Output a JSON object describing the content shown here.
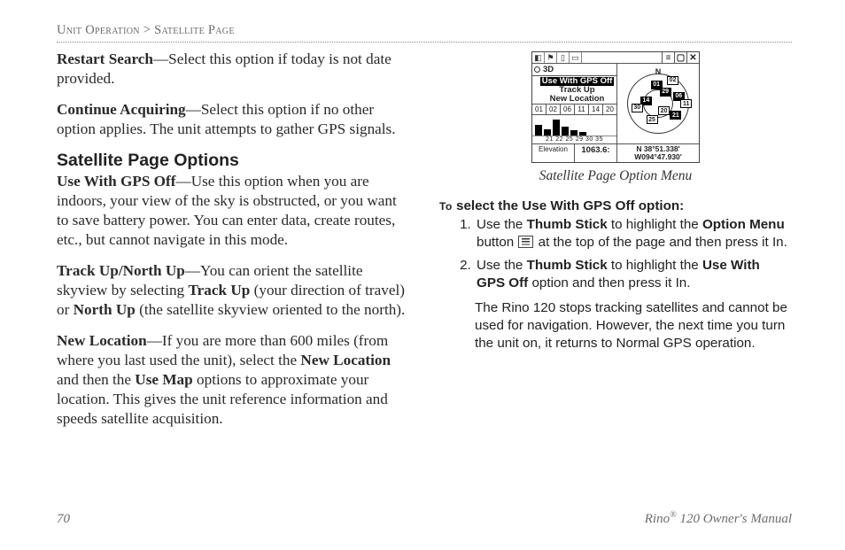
{
  "breadcrumb": {
    "section": "Unit Operation",
    "sep": ">",
    "page": "Satellite Page"
  },
  "left": {
    "p1_b": "Restart Search",
    "p1_t": "—Select this option if today is not date provided.",
    "p2_b": "Continue Acquiring",
    "p2_t": "—Select this option if no other option applies. The unit attempts to gather GPS signals.",
    "h": "Satellite Page Options",
    "p3_b": "Use With GPS Off",
    "p3_t": "—Use this option when you are indoors, your view of the sky is obstructed, or you want to save battery power. You can enter data, create routes, etc., but cannot navigate in this mode.",
    "p4_b1": "Track Up/North Up",
    "p4_t1": "—You can orient the satellite skyview by selecting ",
    "p4_b2": "Track Up",
    "p4_t2": " (your direction of travel) or ",
    "p4_b3": "North Up",
    "p4_t3": " (the satellite skyview oriented to the north).",
    "p5_b1": "New Location",
    "p5_t1": "—If you are more than 600 miles (from where you last used the unit), select the ",
    "p5_b2": "New Location",
    "p5_t2": " and then the ",
    "p5_b3": "Use Map",
    "p5_t3": " options to approximate your location. This gives the unit reference information and speeds satellite acquisition."
  },
  "right": {
    "caption": "Satellite Page Option Menu",
    "device": {
      "topbar_icons": [
        "◧",
        "⚑",
        "▯",
        "▭"
      ],
      "topbar_right": [
        "≡",
        "▢",
        "✕"
      ],
      "menu": {
        "label_3d": "3D",
        "items": [
          "Use With GPS Off",
          "Track Up",
          "New Location"
        ],
        "selected_index": 0
      },
      "stats_row": [
        "01",
        "02",
        "06",
        "11",
        "14",
        "20"
      ],
      "bar_lbl": "21 22 25 29 30 35",
      "elev_label": "Elevation",
      "elev_value": "1063.6:",
      "coords_line1": "N  38°51.338'",
      "coords_line2": "W094°47.930'",
      "sky_n": "N",
      "sats": [
        "01",
        "02",
        "06",
        "11",
        "14",
        "20",
        "21",
        "25",
        "29",
        "30"
      ]
    },
    "instr_head_to": "To",
    "instr_head_rest": " select the Use With GPS Off option:",
    "step1_a": "Use the ",
    "step1_b1": "Thumb Stick",
    "step1_b": " to highlight the ",
    "step1_b2": "Option Menu",
    "step1_c": " button ",
    "step1_d": " at the top of the page and then press it In.",
    "step2_a": "Use the ",
    "step2_b1": "Thumb Stick",
    "step2_b": " to highlight the ",
    "step2_b2": "Use With GPS Off",
    "step2_c": " option and then press it In.",
    "note": "The Rino 120 stops tracking satellites and cannot be used for navigation. However, the next time you turn the unit on, it returns to Normal GPS operation."
  },
  "footer": {
    "page_num": "70",
    "product": "Rino",
    "reg": "®",
    "rest": " 120 Owner's Manual"
  }
}
